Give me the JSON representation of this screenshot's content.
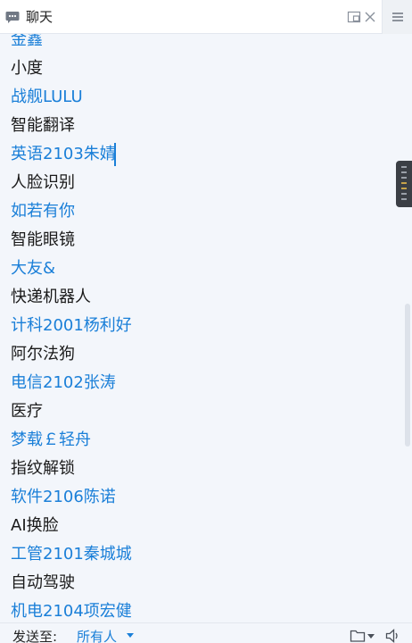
{
  "header": {
    "title": "聊天",
    "icons": [
      "chat-bubble-icon",
      "popout-icon",
      "close-icon",
      "menu-icon"
    ]
  },
  "messages": [
    {
      "kind": "name",
      "text": "金鑫"
    },
    {
      "kind": "text",
      "text": "小度"
    },
    {
      "kind": "name",
      "text": "战舰LULU"
    },
    {
      "kind": "text",
      "text": "智能翻译"
    },
    {
      "kind": "name",
      "text": "英语2103朱婧"
    },
    {
      "kind": "text",
      "text": "人脸识别"
    },
    {
      "kind": "name",
      "text": "如若有你"
    },
    {
      "kind": "text",
      "text": "智能眼镜"
    },
    {
      "kind": "name",
      "text": "大友&"
    },
    {
      "kind": "text",
      "text": "快递机器人"
    },
    {
      "kind": "name",
      "text": "计科2001杨利好"
    },
    {
      "kind": "text",
      "text": "阿尔法狗"
    },
    {
      "kind": "name",
      "text": "电信2102张涛"
    },
    {
      "kind": "text",
      "text": "医疗"
    },
    {
      "kind": "name",
      "text": "梦载￡轻舟"
    },
    {
      "kind": "text",
      "text": "指纹解锁"
    },
    {
      "kind": "name",
      "text": "软件2106陈诺"
    },
    {
      "kind": "text",
      "text": "AI换脸"
    },
    {
      "kind": "name",
      "text": "工管2101秦城城"
    },
    {
      "kind": "text",
      "text": "自动驾驶"
    },
    {
      "kind": "name",
      "text": "机电2104项宏健"
    }
  ],
  "footer": {
    "send_to_label": "发送至:",
    "recipient": "所有人",
    "icons": [
      "caret-down-icon",
      "folder-icon",
      "speaker-icon"
    ]
  },
  "colors": {
    "name": "#1a7fd8",
    "text": "#1a1a1a",
    "background": "#f3f6fb"
  }
}
